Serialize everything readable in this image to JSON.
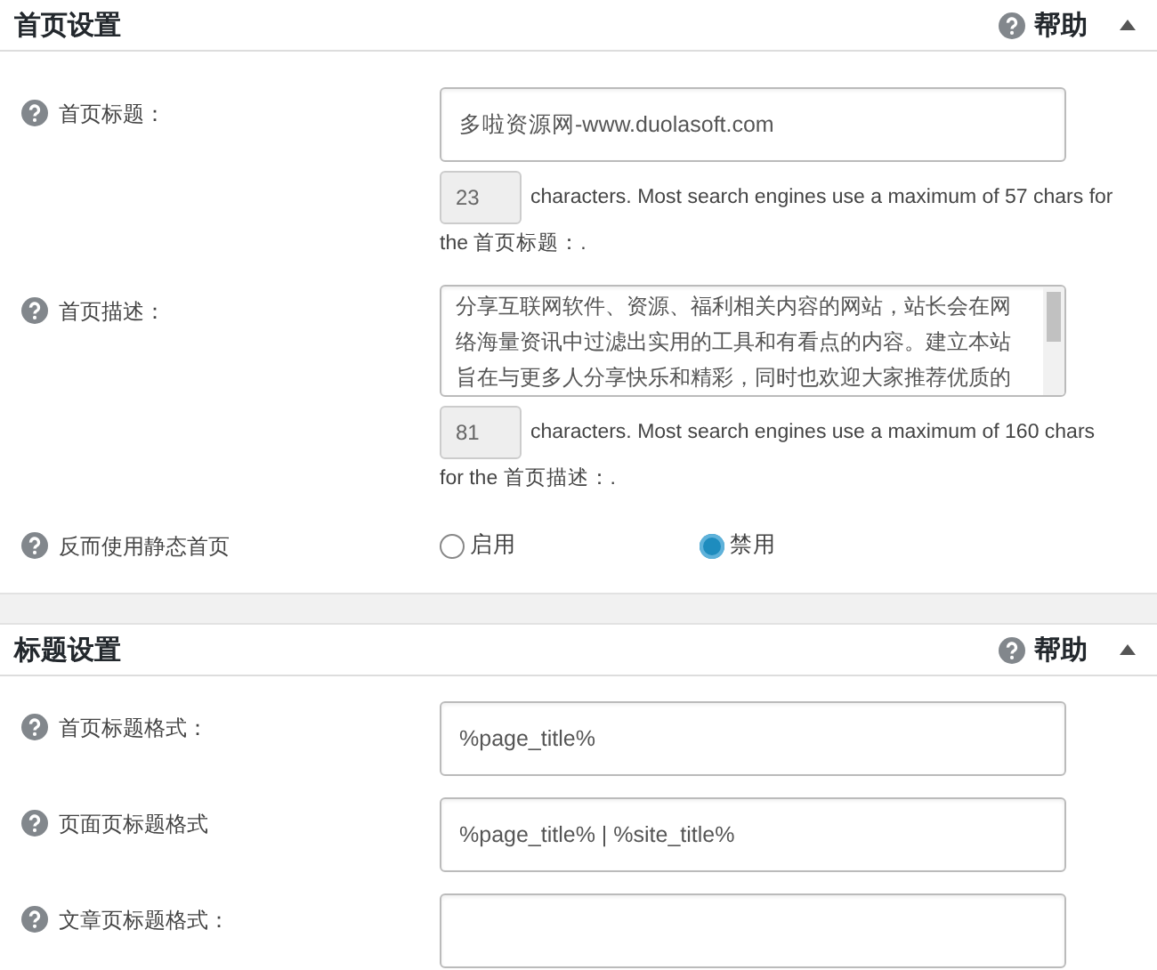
{
  "panels": [
    {
      "title": "首页设置",
      "help": "帮助",
      "expanded": true,
      "rows": [
        {
          "kind": "text",
          "label": "首页标题：",
          "value": "多啦资源网-www.duolasoft.com",
          "count": "23",
          "note_lines": [
            "characters. Most search engines use a maximum of 57 chars for",
            "the 首页标题：."
          ]
        },
        {
          "kind": "textarea",
          "label": "首页描述：",
          "value_lines": [
            "分享互联网软件、资源、福利相关内容的网站，站长会在网",
            "络海量资讯中过滤出实用的工具和有看点的内容。建立本站",
            "旨在与更多人分享快乐和精彩，同时也欢迎大家推荐优质的"
          ],
          "count": "81",
          "note_lines": [
            "characters. Most search engines use a maximum of 160 chars",
            "for the 首页描述：."
          ]
        },
        {
          "kind": "radio",
          "label": "反而使用静态首页",
          "options": [
            {
              "label": "启用",
              "selected": false
            },
            {
              "label": "禁用",
              "selected": true
            }
          ]
        }
      ]
    },
    {
      "title": "标题设置",
      "help": "帮助",
      "expanded": true,
      "rows": [
        {
          "kind": "text",
          "label": "首页标题格式：",
          "value": "%page_title%"
        },
        {
          "kind": "text",
          "label": "页面页标题格式",
          "value": "%page_title% | %site_title%"
        },
        {
          "kind": "text",
          "label": "文章页标题格式："
        }
      ]
    }
  ]
}
